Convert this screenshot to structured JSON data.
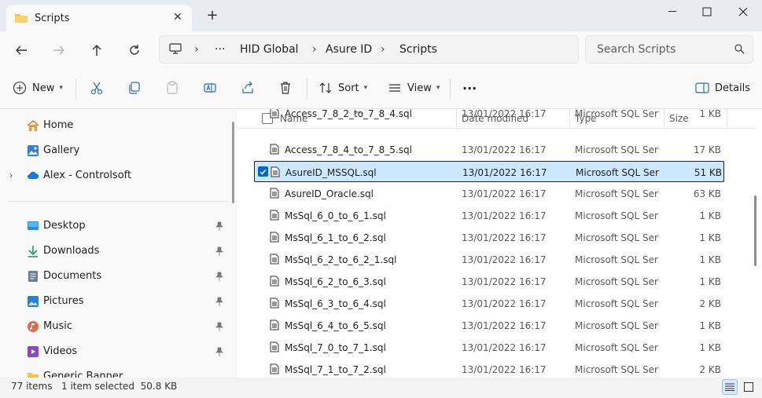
{
  "window": {
    "tab_title": "Scripts",
    "new_tab": "+"
  },
  "address": {
    "overflow": "···",
    "breadcrumbs": [
      "HID Global",
      "Asure ID",
      "Scripts"
    ]
  },
  "search": {
    "placeholder": "Search Scripts"
  },
  "toolbar": {
    "new_label": "New",
    "sort_label": "Sort",
    "view_label": "View",
    "more_label": "···",
    "details_label": "Details"
  },
  "sidebar": {
    "top_items": [
      {
        "label": "Home",
        "icon": "home-icon"
      },
      {
        "label": "Gallery",
        "icon": "gallery-icon"
      },
      {
        "label": "Alex - Controlsoft",
        "icon": "onedrive-icon"
      }
    ],
    "pinned_items": [
      {
        "label": "Desktop",
        "icon": "desktop-icon"
      },
      {
        "label": "Downloads",
        "icon": "downloads-icon"
      },
      {
        "label": "Documents",
        "icon": "documents-icon"
      },
      {
        "label": "Pictures",
        "icon": "pictures-icon"
      },
      {
        "label": "Music",
        "icon": "music-icon"
      },
      {
        "label": "Videos",
        "icon": "videos-icon"
      },
      {
        "label": "Generic Banner",
        "icon": "folder-icon"
      }
    ]
  },
  "list": {
    "columns": {
      "name": "Name",
      "date": "Date modified",
      "type": "Type",
      "size": "Size"
    },
    "rows": [
      {
        "name": "Access_7_8_2_to_7_8_4.sql",
        "date": "13/01/2022 16:17",
        "type": "Microsoft SQL Server Query File",
        "size": "1 KB"
      },
      {
        "name": "Access_7_8_4_to_7_8_5.sql",
        "date": "13/01/2022 16:17",
        "type": "Microsoft SQL Server Query File",
        "size": "17 KB"
      },
      {
        "name": "AsureID_MSSQL.sql",
        "date": "13/01/2022 16:17",
        "type": "Microsoft SQL Server Query File",
        "size": "51 KB",
        "selected": true
      },
      {
        "name": "AsureID_Oracle.sql",
        "date": "13/01/2022 16:17",
        "type": "Microsoft SQL Server Query File",
        "size": "63 KB"
      },
      {
        "name": "MsSql_6_0_to_6_1.sql",
        "date": "13/01/2022 16:17",
        "type": "Microsoft SQL Server Query File",
        "size": "1 KB"
      },
      {
        "name": "MsSql_6_1_to_6_2.sql",
        "date": "13/01/2022 16:17",
        "type": "Microsoft SQL Server Query File",
        "size": "1 KB"
      },
      {
        "name": "MsSql_6_2_to_6_2_1.sql",
        "date": "13/01/2022 16:17",
        "type": "Microsoft SQL Server Query File",
        "size": "1 KB"
      },
      {
        "name": "MsSql_6_2_to_6_3.sql",
        "date": "13/01/2022 16:17",
        "type": "Microsoft SQL Server Query File",
        "size": "1 KB"
      },
      {
        "name": "MsSql_6_3_to_6_4.sql",
        "date": "13/01/2022 16:17",
        "type": "Microsoft SQL Server Query File",
        "size": "2 KB"
      },
      {
        "name": "MsSql_6_4_to_6_5.sql",
        "date": "13/01/2022 16:17",
        "type": "Microsoft SQL Server Query File",
        "size": "1 KB"
      },
      {
        "name": "MsSql_7_0_to_7_1.sql",
        "date": "13/01/2022 16:17",
        "type": "Microsoft SQL Server Query File",
        "size": "1 KB"
      },
      {
        "name": "MsSql_7_1_to_7_2.sql",
        "date": "13/01/2022 16:17",
        "type": "Microsoft SQL Server Query File",
        "size": "2 KB"
      }
    ]
  },
  "status": {
    "item_count": "77 items",
    "selection": "1 item selected  50.8 KB"
  },
  "colors": {
    "selection_bg": "#cce8ff",
    "accent": "#0067c0"
  }
}
